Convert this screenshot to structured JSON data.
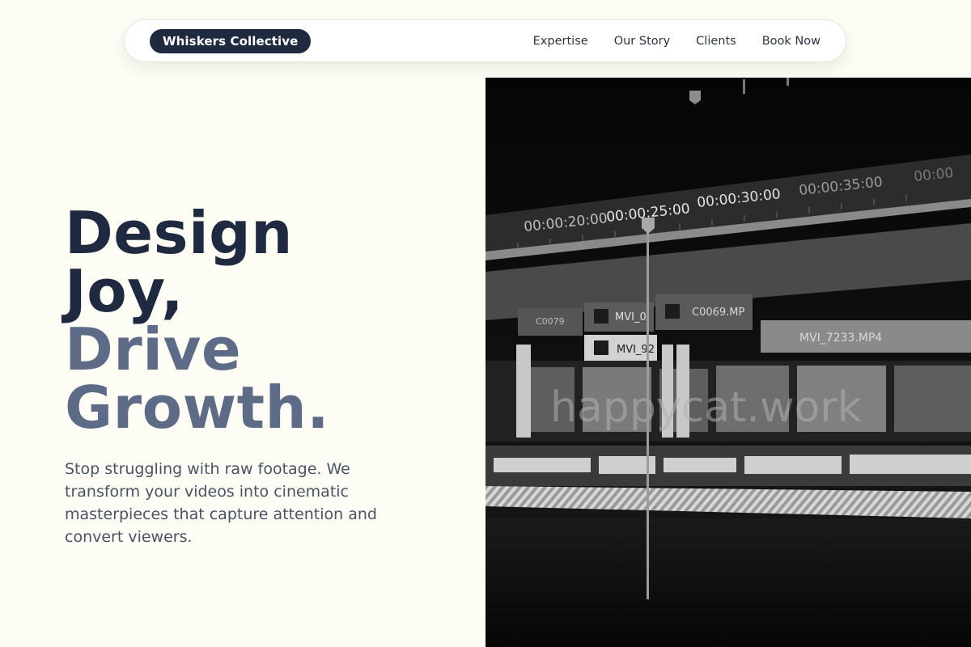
{
  "brand": {
    "name": "Whiskers Collective"
  },
  "nav": {
    "links": [
      "Expertise",
      "Our Story",
      "Clients",
      "Book Now"
    ]
  },
  "hero": {
    "line1": "Design",
    "line2": "Joy,",
    "line3": "Drive",
    "line4": "Growth.",
    "subtitle": "Stop struggling with raw footage. We transform your videos into cinematic masterpieces that capture attention and convert viewers."
  },
  "image": {
    "timecodes": [
      "00:00:20:00",
      "00:00:25:00",
      "00:00:30:00",
      "00:00:35:00",
      "00:00"
    ],
    "clips": [
      "C0079",
      "MVI_0",
      "C0069.MP",
      "MVI_92",
      "MVI_7233.MP4"
    ],
    "watermark": "happycat.work"
  },
  "colors": {
    "dark": "#1f2a40",
    "muted": "#5e6b86",
    "background": "#fdfdf5"
  }
}
